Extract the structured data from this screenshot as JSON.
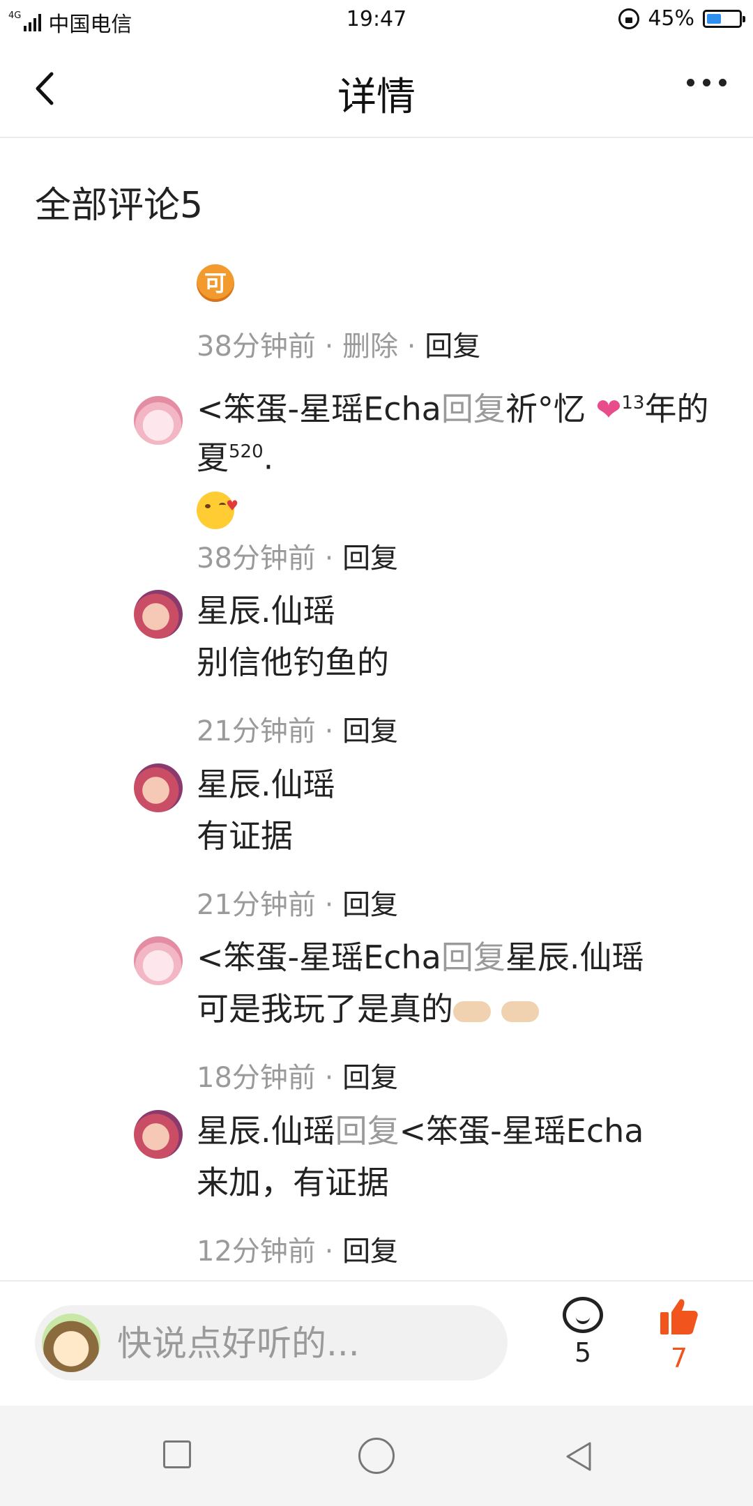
{
  "status_bar": {
    "network": "4G",
    "carrier": "中国电信",
    "time": "19:47",
    "battery": "45%",
    "battery_level": 0.45
  },
  "header": {
    "title": "详情",
    "back_icon": "chevron-left-icon",
    "more_icon": "more-dots-icon"
  },
  "comments_header": "全部评论5",
  "replies": [
    {
      "emoji": "可",
      "time": "38分钟前",
      "delete_label": "删除",
      "reply_label": "回复",
      "separator": "·"
    },
    {
      "author": "<笨蛋-星瑶Echa",
      "reply_word": "回复",
      "target_a": "祈°忆",
      "heart": "❤",
      "sup_a": "13",
      "target_b": "年的夏",
      "sup_b": "520",
      "target_c": ".",
      "time": "38分钟前",
      "reply_label": "回复",
      "separator": "·"
    },
    {
      "author": "星辰.仙瑶",
      "text": "别信他钓鱼的",
      "time": "21分钟前",
      "reply_label": "回复",
      "separator": "·"
    },
    {
      "author": "星辰.仙瑶",
      "text": "有证据",
      "time": "21分钟前",
      "reply_label": "回复",
      "separator": "·"
    },
    {
      "author": "<笨蛋-星瑶Echa",
      "reply_word": "回复",
      "target": "星辰.仙瑶",
      "text": "可是我玩了是真的",
      "time": "18分钟前",
      "reply_label": "回复",
      "separator": "·"
    },
    {
      "author": "星辰.仙瑶",
      "reply_word": "回复",
      "target": "<笨蛋-星瑶Echa",
      "text": "来加，有证据",
      "time": "12分钟前",
      "reply_label": "回复",
      "separator": "·"
    }
  ],
  "bottom_bar": {
    "input_placeholder": "快说点好听的...",
    "comment_count": "5",
    "like_count": "7",
    "like_color": "#f2541d"
  }
}
